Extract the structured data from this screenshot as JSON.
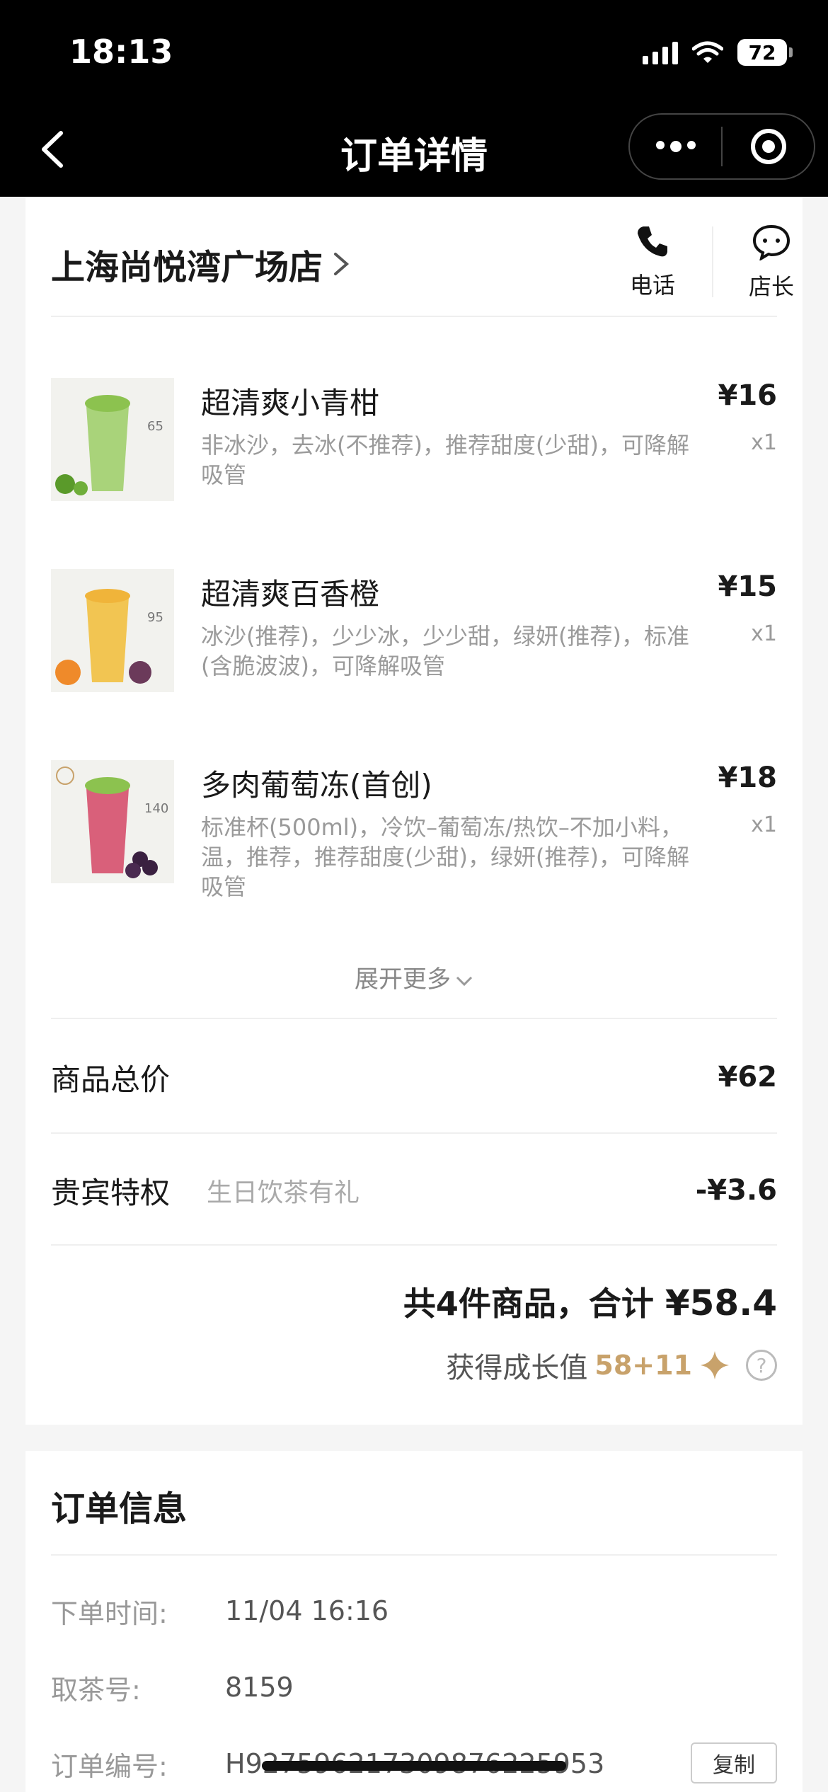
{
  "status_bar": {
    "time": "18:13",
    "battery": "72"
  },
  "nav": {
    "title": "订单详情"
  },
  "store": {
    "name": "上海尚悦湾广场店",
    "phone_label": "电话",
    "manager_label": "店长"
  },
  "items": [
    {
      "name": "超清爽小青柑",
      "desc": "非冰沙，去冰(不推荐)，推荐甜度(少甜)，可降解吸管",
      "price": "¥16",
      "qty": "x1",
      "thumb_color": "#a9d37a",
      "thumb_label": "65"
    },
    {
      "name": "超清爽百香橙",
      "desc": "冰沙(推荐)，少少冰，少少甜，绿妍(推荐)，标准(含脆波波)，可降解吸管",
      "price": "¥15",
      "qty": "x1",
      "thumb_color": "#f2c552",
      "thumb_label": "95"
    },
    {
      "name": "多肉葡萄冻(首创)",
      "desc": "标准杯(500ml)，冷饮–葡萄冻/热饮–不加小料，温，推荐，推荐甜度(少甜)，绿妍(推荐)，可降解吸管",
      "price": "¥18",
      "qty": "x1",
      "thumb_color": "#d9607a",
      "thumb_label": "140"
    }
  ],
  "expand_label": "展开更多",
  "subtotal": {
    "label": "商品总价",
    "value": "¥62"
  },
  "vip": {
    "label": "贵宾特权",
    "sub": "生日饮茶有礼",
    "value": "-¥3.6"
  },
  "summary": {
    "text": "共4件商品，合计 ",
    "amount": "¥58.4"
  },
  "growth": {
    "label": "获得成长值 ",
    "value": "58+11"
  },
  "order_info": {
    "title": "订单信息",
    "time_label": "下单时间:",
    "time_value": "11/04 16:16",
    "pickup_label": "取茶号:",
    "pickup_value": "8159",
    "number_label": "订单编号:",
    "number_value": "H927596217309876225953",
    "copy_label": "复制"
  },
  "colors": {
    "accent_gold": "#c8a26b",
    "topbar": "#000000"
  }
}
